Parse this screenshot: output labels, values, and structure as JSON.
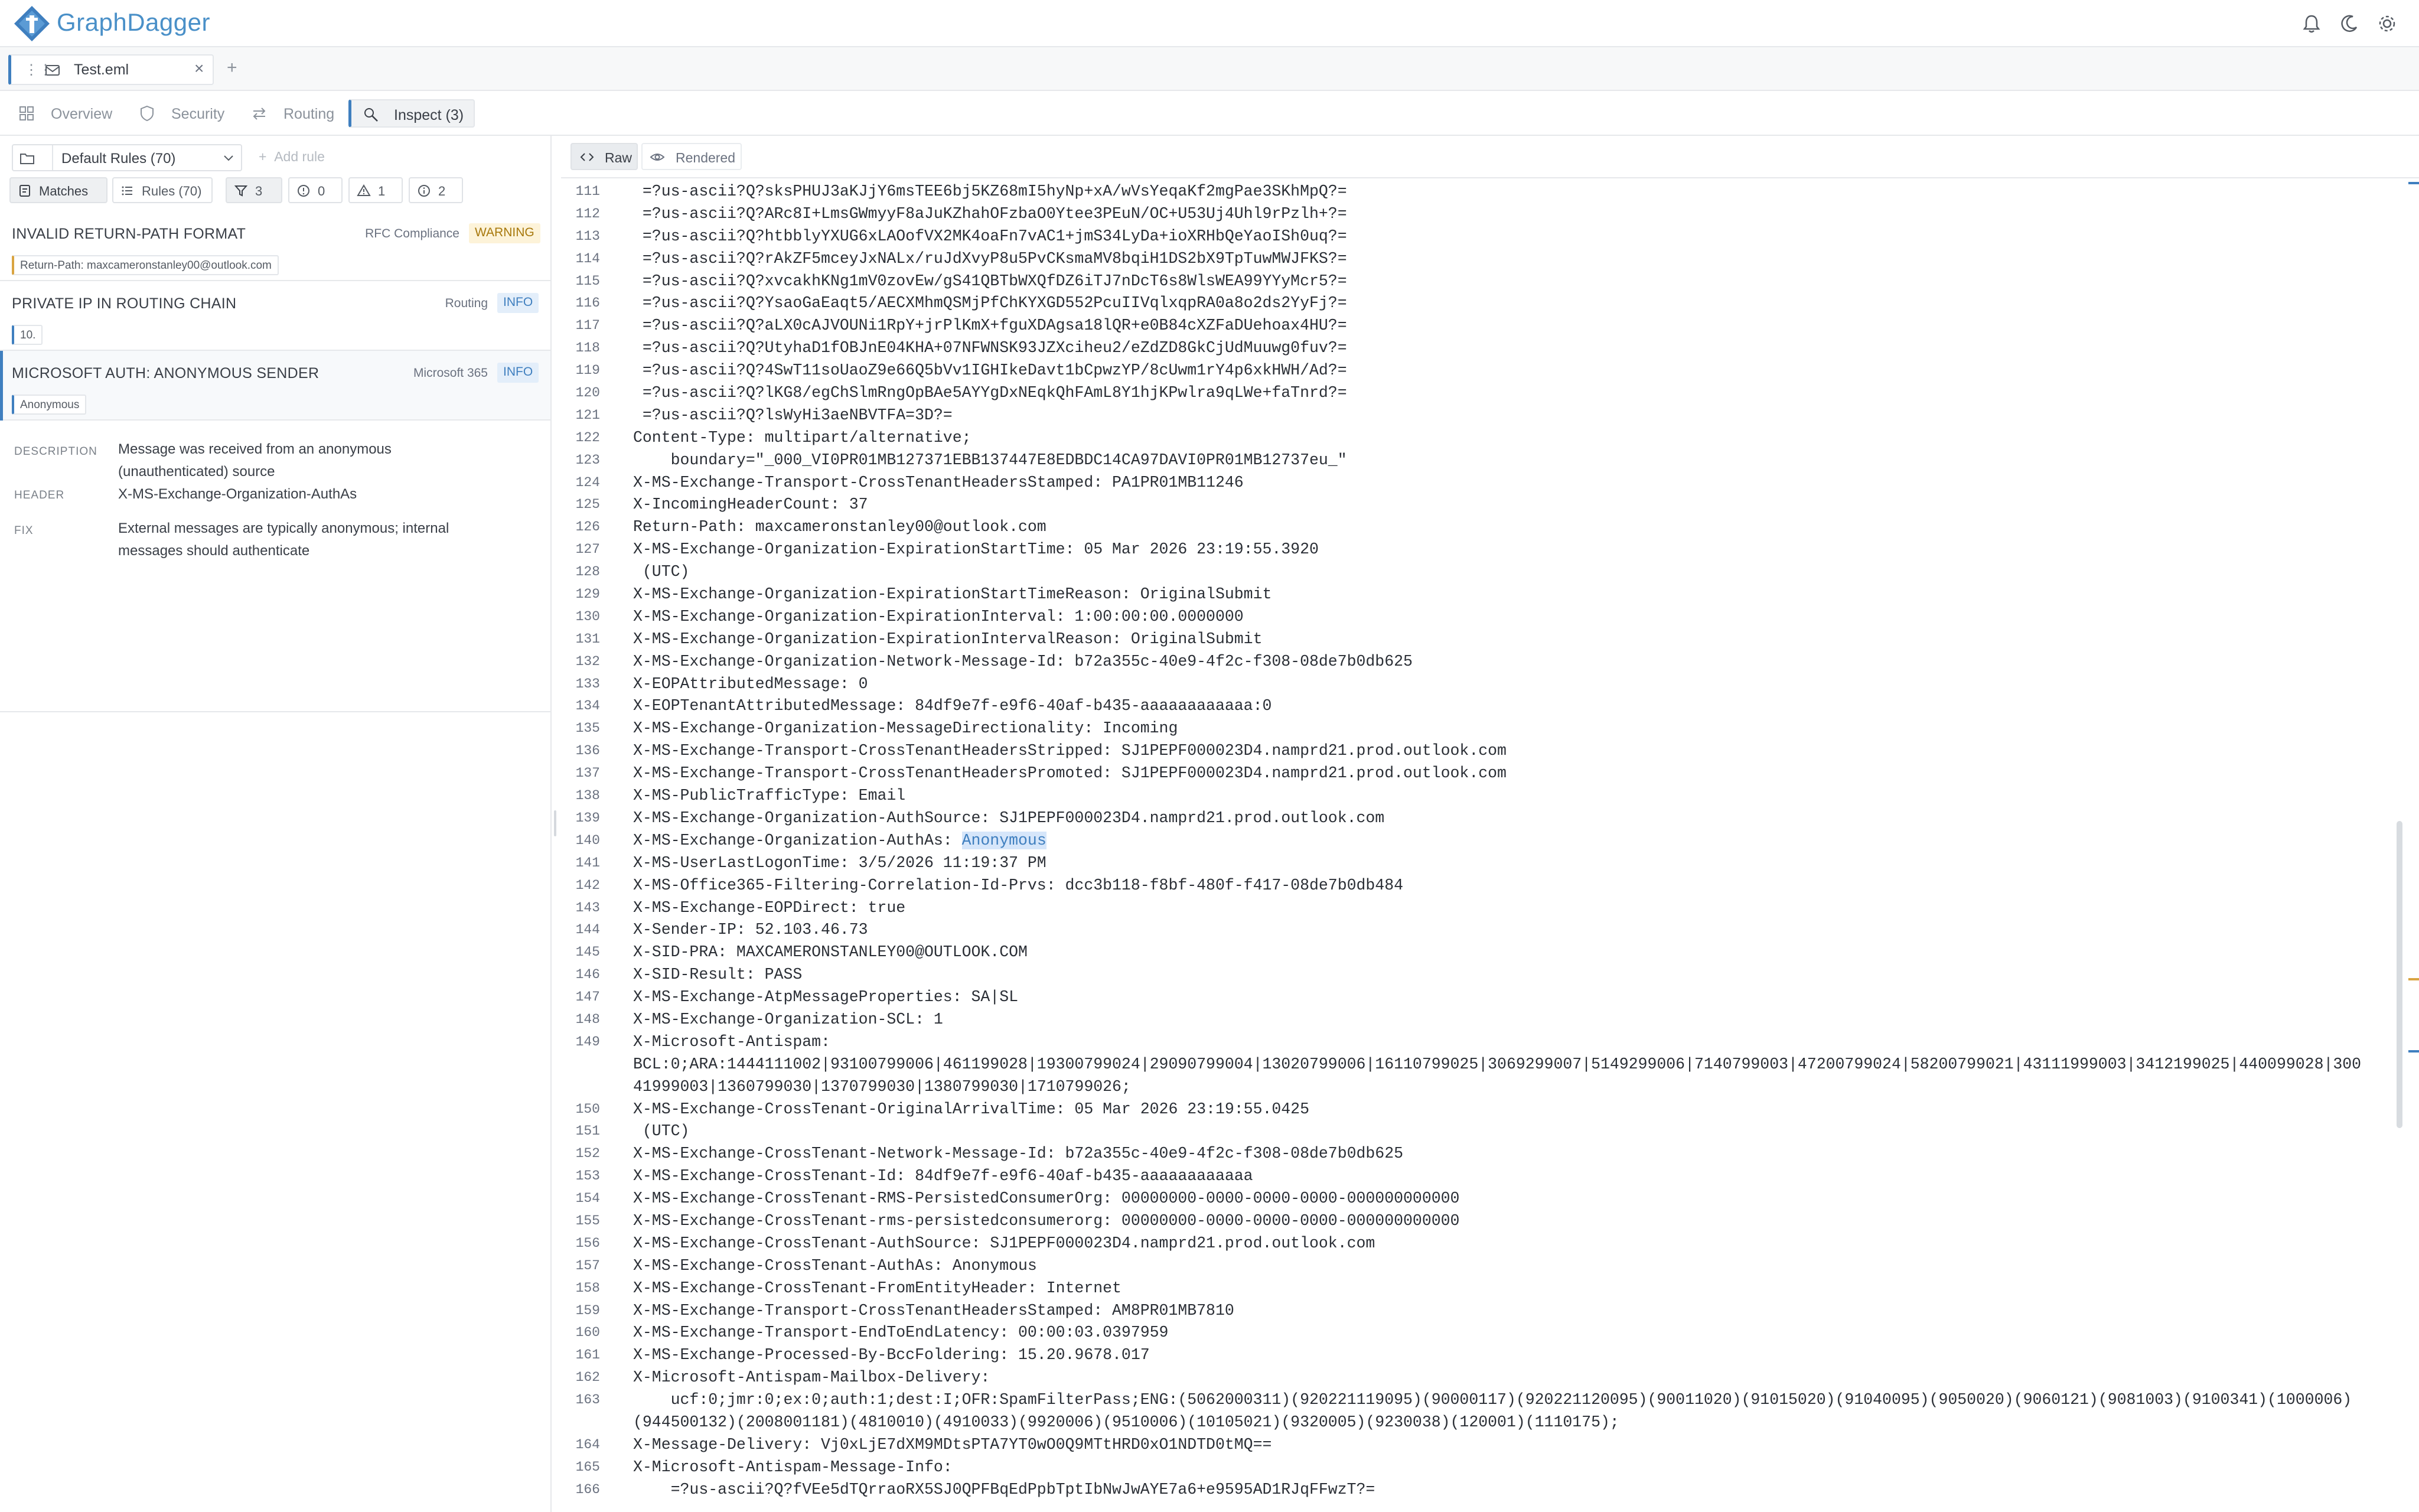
{
  "app": {
    "name": "GraphDagger"
  },
  "header": {
    "icons": [
      "bell-icon",
      "moon-icon",
      "gear-icon"
    ]
  },
  "tabs": [
    {
      "label": "Test.eml",
      "active": true
    }
  ],
  "nav": {
    "items": [
      {
        "label": "Overview",
        "icon": "grid-icon"
      },
      {
        "label": "Security",
        "icon": "shield-icon"
      },
      {
        "label": "Routing",
        "icon": "arrows-icon"
      },
      {
        "label": "Inspect (3)",
        "icon": "inspect-icon",
        "active": true
      }
    ]
  },
  "rules": {
    "ruleset": "Default Rules (70)",
    "add_rule": "Add rule",
    "matches_label": "Matches",
    "rules_label": "Rules (70)",
    "filter_count": "3",
    "error_count": "0",
    "warning_count": "1",
    "info_count": "2"
  },
  "matches": [
    {
      "title": "INVALID RETURN-PATH FORMAT",
      "category": "RFC Compliance",
      "severity": "WARNING",
      "evidence": "Return-Path: maxcameronstanley00@outlook.com"
    },
    {
      "title": "PRIVATE IP IN ROUTING CHAIN",
      "category": "Routing",
      "severity": "INFO",
      "evidence": "10."
    },
    {
      "title": "MICROSOFT AUTH: ANONYMOUS SENDER",
      "category": "Microsoft 365",
      "severity": "INFO",
      "evidence": "Anonymous"
    }
  ],
  "detail": {
    "description_label": "DESCRIPTION",
    "description": "Message was received from an anonymous (unauthenticated) source",
    "header_label": "HEADER",
    "header": "X-MS-Exchange-Organization-AuthAs",
    "fix_label": "FIX",
    "fix": "External messages are typically anonymous; internal messages should authenticate"
  },
  "viewer": {
    "raw_label": "Raw",
    "rendered_label": "Rendered",
    "highlight": "Anonymous",
    "lines": [
      {
        "n": "111",
        "t": " =?us-ascii?Q?sksPHUJ3aKJjY6msTEE6bj5KZ68mI5hyNp+xA/wVsYeqaKf2mgPae3SKhMpQ?="
      },
      {
        "n": "112",
        "t": " =?us-ascii?Q?ARc8I+LmsGWmyyF8aJuKZhahOFzbaO0Ytee3PEuN/OC+U53Uj4Uhl9rPzlh+?="
      },
      {
        "n": "113",
        "t": " =?us-ascii?Q?htbblyYXUG6xLAOofVX2MK4oaFn7vAC1+jmS34LyDa+ioXRHbQeYaoISh0uq?="
      },
      {
        "n": "114",
        "t": " =?us-ascii?Q?rAkZF5mceyJxNALx/ruJdXvyP8u5PvCKsmaMV8bqiH1DS2bX9TpTuwMWJFKS?="
      },
      {
        "n": "115",
        "t": " =?us-ascii?Q?xvcakhKNg1mV0zovEw/gS41QBTbWXQfDZ6iTJ7nDcT6s8WlsWEA99YYyMcr5?="
      },
      {
        "n": "116",
        "t": " =?us-ascii?Q?YsaoGaEaqt5/AECXMhmQSMjPfChKYXGD552PcuIIVqlxqpRA0a8o2ds2YyFj?="
      },
      {
        "n": "117",
        "t": " =?us-ascii?Q?aLX0cAJVOUNi1RpY+jrPlKmX+fguXDAgsa18lQR+e0B84cXZFaDUehoax4HU?="
      },
      {
        "n": "118",
        "t": " =?us-ascii?Q?UtyhaD1fOBJnE04KHA+07NFWNSK93JZXciheu2/eZdZD8GkCjUdMuuwg0fuv?="
      },
      {
        "n": "119",
        "t": " =?us-ascii?Q?4SwT11soUaoZ9e66Q5bVv1IGHIkeDavt1bCpwzYP/8cUwm1rY4p6xkHWH/Ad?="
      },
      {
        "n": "120",
        "t": " =?us-ascii?Q?lKG8/egChSlmRngOpBAe5AYYgDxNEqkQhFAmL8Y1hjKPwlra9qLWe+faTnrd?="
      },
      {
        "n": "121",
        "t": " =?us-ascii?Q?lsWyHi3aeNBVTFA=3D?="
      },
      {
        "n": "122",
        "t": "Content-Type: multipart/alternative;"
      },
      {
        "n": "123",
        "t": "    boundary=\"_000_VI0PR01MB127371EBB137447E8EDBDC14CA97DAVI0PR01MB12737eu_\""
      },
      {
        "n": "124",
        "t": "X-MS-Exchange-Transport-CrossTenantHeadersStamped: PA1PR01MB11246"
      },
      {
        "n": "125",
        "t": "X-IncomingHeaderCount: 37"
      },
      {
        "n": "126",
        "t": "Return-Path: maxcameronstanley00@outlook.com"
      },
      {
        "n": "127",
        "t": "X-MS-Exchange-Organization-ExpirationStartTime: 05 Mar 2026 23:19:55.3920"
      },
      {
        "n": "128",
        "t": " (UTC)"
      },
      {
        "n": "129",
        "t": "X-MS-Exchange-Organization-ExpirationStartTimeReason: OriginalSubmit"
      },
      {
        "n": "130",
        "t": "X-MS-Exchange-Organization-ExpirationInterval: 1:00:00:00.0000000"
      },
      {
        "n": "131",
        "t": "X-MS-Exchange-Organization-ExpirationIntervalReason: OriginalSubmit"
      },
      {
        "n": "132",
        "t": "X-MS-Exchange-Organization-Network-Message-Id: b72a355c-40e9-4f2c-f308-08de7b0db625"
      },
      {
        "n": "133",
        "t": "X-EOPAttributedMessage: 0"
      },
      {
        "n": "134",
        "t": "X-EOPTenantAttributedMessage: 84df9e7f-e9f6-40af-b435-aaaaaaaaaaaa:0"
      },
      {
        "n": "135",
        "t": "X-MS-Exchange-Organization-MessageDirectionality: Incoming"
      },
      {
        "n": "136",
        "t": "X-MS-Exchange-Transport-CrossTenantHeadersStripped: SJ1PEPF000023D4.namprd21.prod.outlook.com"
      },
      {
        "n": "137",
        "t": "X-MS-Exchange-Transport-CrossTenantHeadersPromoted: SJ1PEPF000023D4.namprd21.prod.outlook.com"
      },
      {
        "n": "138",
        "t": "X-MS-PublicTrafficType: Email"
      },
      {
        "n": "139",
        "t": "X-MS-Exchange-Organization-AuthSource: SJ1PEPF000023D4.namprd21.prod.outlook.com"
      },
      {
        "n": "140",
        "t": "X-MS-Exchange-Organization-AuthAs: ",
        "hl": "Anonymous"
      },
      {
        "n": "141",
        "t": "X-MS-UserLastLogonTime: 3/5/2026 11:19:37 PM"
      },
      {
        "n": "142",
        "t": "X-MS-Office365-Filtering-Correlation-Id-Prvs: dcc3b118-f8bf-480f-f417-08de7b0db484"
      },
      {
        "n": "143",
        "t": "X-MS-Exchange-EOPDirect: true"
      },
      {
        "n": "144",
        "t": "X-Sender-IP: 52.103.46.73"
      },
      {
        "n": "145",
        "t": "X-SID-PRA: MAXCAMERONSTANLEY00@OUTLOOK.COM"
      },
      {
        "n": "146",
        "t": "X-SID-Result: PASS"
      },
      {
        "n": "147",
        "t": "X-MS-Exchange-AtpMessageProperties: SA|SL"
      },
      {
        "n": "148",
        "t": "X-MS-Exchange-Organization-SCL: 1"
      },
      {
        "n": "149",
        "t": "X-Microsoft-Antispam:"
      },
      {
        "n": "",
        "t": "BCL:0;ARA:1444111002|93100799006|461199028|19300799024|29090799004|13020799006|16110799025|3069299007|5149299006|7140799003|47200799024|58200799021|43111999003|3412199025|440099028|300"
      },
      {
        "n": "",
        "t": "41999003|1360799030|1370799030|1380799030|1710799026;"
      },
      {
        "n": "150",
        "t": "X-MS-Exchange-CrossTenant-OriginalArrivalTime: 05 Mar 2026 23:19:55.0425"
      },
      {
        "n": "151",
        "t": " (UTC)"
      },
      {
        "n": "152",
        "t": "X-MS-Exchange-CrossTenant-Network-Message-Id: b72a355c-40e9-4f2c-f308-08de7b0db625"
      },
      {
        "n": "153",
        "t": "X-MS-Exchange-CrossTenant-Id: 84df9e7f-e9f6-40af-b435-aaaaaaaaaaaa"
      },
      {
        "n": "154",
        "t": "X-MS-Exchange-CrossTenant-RMS-PersistedConsumerOrg: 00000000-0000-0000-0000-000000000000"
      },
      {
        "n": "155",
        "t": "X-MS-Exchange-CrossTenant-rms-persistedconsumerorg: 00000000-0000-0000-0000-000000000000"
      },
      {
        "n": "156",
        "t": "X-MS-Exchange-CrossTenant-AuthSource: SJ1PEPF000023D4.namprd21.prod.outlook.com"
      },
      {
        "n": "157",
        "t": "X-MS-Exchange-CrossTenant-AuthAs: Anonymous"
      },
      {
        "n": "158",
        "t": "X-MS-Exchange-CrossTenant-FromEntityHeader: Internet"
      },
      {
        "n": "159",
        "t": "X-MS-Exchange-Transport-CrossTenantHeadersStamped: AM8PR01MB7810"
      },
      {
        "n": "160",
        "t": "X-MS-Exchange-Transport-EndToEndLatency: 00:00:03.0397959"
      },
      {
        "n": "161",
        "t": "X-MS-Exchange-Processed-By-BccFoldering: 15.20.9678.017"
      },
      {
        "n": "162",
        "t": "X-Microsoft-Antispam-Mailbox-Delivery:"
      },
      {
        "n": "163",
        "t": "    ucf:0;jmr:0;ex:0;auth:1;dest:I;OFR:SpamFilterPass;ENG:(5062000311)(920221119095)(90000117)(920221120095)(90011020)(91015020)(91040095)(9050020)(9060121)(9081003)(9100341)(1000006)"
      },
      {
        "n": "",
        "t": "(944500132)(2008001181)(4810010)(4910033)(9920006)(9510006)(10105021)(9320005)(9230038)(120001)(1110175);"
      },
      {
        "n": "164",
        "t": "X-Message-Delivery: Vj0xLjE7dXM9MDtsPTA7YT0wO0Q9MTtHRD0xO1NDTD0tMQ=="
      },
      {
        "n": "165",
        "t": "X-Microsoft-Antispam-Message-Info:"
      },
      {
        "n": "166",
        "t": "    =?us-ascii?Q?fVEe5dTQrraoRX5SJ0QPFBqEdPpbTptIbNwJwAYE7a6+e9595AD1RJqFFwzT?="
      }
    ]
  },
  "colors": {
    "accent": "#3f7fbf",
    "warning": "#d9a441",
    "info": "#3f7fbf",
    "highlight_bg": "#d6e6fa"
  }
}
